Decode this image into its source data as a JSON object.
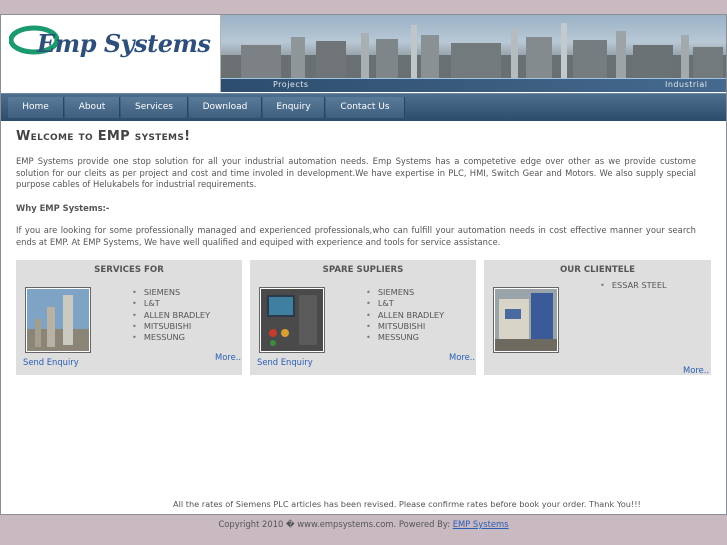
{
  "logo": {
    "text": "Emp Systems"
  },
  "banner": {
    "left_label": "Projects",
    "right_label": "Industrial"
  },
  "nav": {
    "items": [
      "Home",
      "About",
      "Services",
      "Download",
      "Enquiry",
      "Contact Us"
    ]
  },
  "content": {
    "title": "Welcome to EMP systems!",
    "intro": "EMP Systems provide one stop solution for all your industrial automation needs. Emp Systems has a competetive edge over other as we provide custome solution for our cleits as per project and cost and time involed in development.We have expertise in PLC, HMI, Switch Gear and Motors. We also supply special purpose cables of Helukabels for industrial requirements.",
    "why_heading": "Why EMP Systems:-",
    "why_text": "If you are looking for some professionally managed and experienced professionals,who can fulfill your automation needs in cost effective manner your search ends at EMP. At EMP Systems, We have well qualified and equiped with experience and tools for service assistance."
  },
  "cards": [
    {
      "title": "SERVICES FOR",
      "items": [
        "SIEMENS",
        "L&T",
        "ALLEN BRADLEY",
        "MITSUBISHI",
        "MESSUNG"
      ],
      "send_enquiry": "Send Enquiry",
      "more": "More.."
    },
    {
      "title": "SPARE SUPLIERS",
      "items": [
        "SIEMENS",
        "L&T",
        "ALLEN BRADLEY",
        "MITSUBISHI",
        "MESSUNG"
      ],
      "send_enquiry": "Send Enquiry",
      "more": "More.."
    },
    {
      "title": "OUR CLIENTELE",
      "items": [
        "ESSAR STEEL"
      ],
      "more": "More.."
    }
  ],
  "notice": "All the rates of Siemens PLC articles has been revised. Please confirme rates before book your order. Thank You!!!",
  "footer": {
    "copyright": "Copyright 2010 � www.empsystems.com. Powered By:",
    "powered_by_link": "EMP Systems"
  },
  "colors": {
    "nav_bg": "#2d4c6b",
    "link": "#2a5eb5",
    "card_bg": "#dedede",
    "page_bg": "#c9b9c1"
  }
}
